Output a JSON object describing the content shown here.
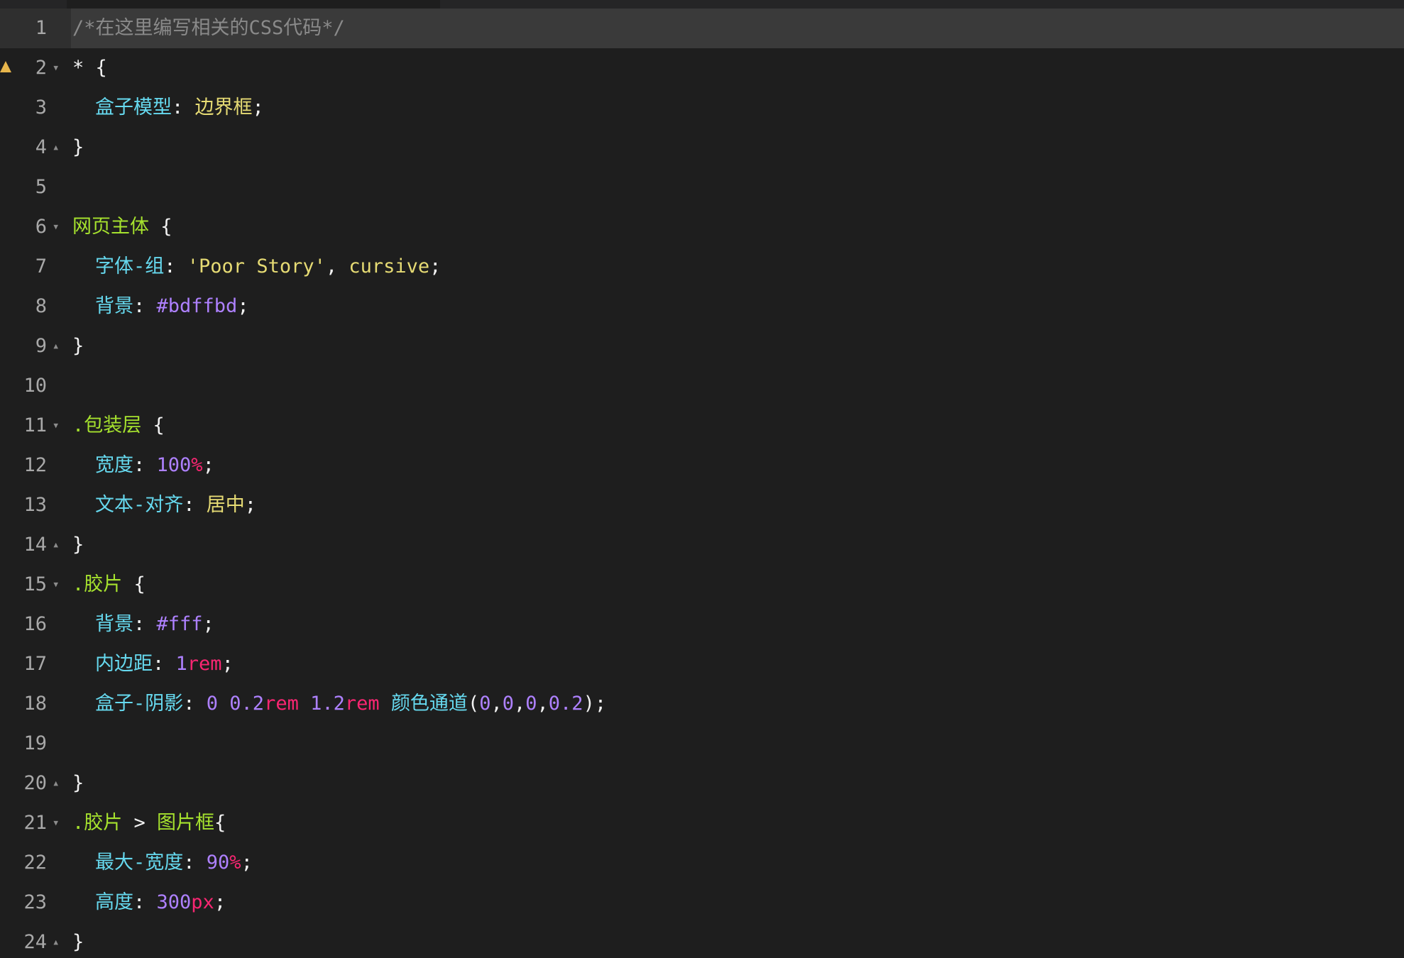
{
  "editor": {
    "lines": [
      {
        "n": "1",
        "fold": "",
        "tokens": [
          [
            "t-comment",
            "/*在这里编写相关的CSS代码*/"
          ]
        ]
      },
      {
        "n": "2",
        "fold": "▼",
        "tokens": [
          [
            "t-punct",
            "* {"
          ]
        ]
      },
      {
        "n": "3",
        "fold": "",
        "indent": 1,
        "tokens": [
          [
            "t-prop",
            "盒子模型"
          ],
          [
            "t-punct",
            ": "
          ],
          [
            "t-kw",
            "边界框"
          ],
          [
            "t-punct",
            ";"
          ]
        ]
      },
      {
        "n": "4",
        "fold": "▲",
        "tokens": [
          [
            "t-punct",
            "}"
          ]
        ]
      },
      {
        "n": "5",
        "fold": "",
        "tokens": []
      },
      {
        "n": "6",
        "fold": "▼",
        "tokens": [
          [
            "t-sel",
            "网页主体"
          ],
          [
            "t-punct",
            " {"
          ]
        ]
      },
      {
        "n": "7",
        "fold": "",
        "indent": 1,
        "tokens": [
          [
            "t-prop",
            "字体-组"
          ],
          [
            "t-punct",
            ": "
          ],
          [
            "t-str",
            "'Poor Story'"
          ],
          [
            "t-punct",
            ", "
          ],
          [
            "t-kw",
            "cursive"
          ],
          [
            "t-punct",
            ";"
          ]
        ]
      },
      {
        "n": "8",
        "fold": "",
        "indent": 1,
        "tokens": [
          [
            "t-prop",
            "背景"
          ],
          [
            "t-punct",
            ": "
          ],
          [
            "t-num",
            "#bdffbd"
          ],
          [
            "t-punct",
            ";"
          ]
        ]
      },
      {
        "n": "9",
        "fold": "▲",
        "tokens": [
          [
            "t-punct",
            "}"
          ]
        ]
      },
      {
        "n": "10",
        "fold": "",
        "tokens": []
      },
      {
        "n": "11",
        "fold": "▼",
        "tokens": [
          [
            "t-sel",
            ".包装层"
          ],
          [
            "t-punct",
            " {"
          ]
        ]
      },
      {
        "n": "12",
        "fold": "",
        "indent": 1,
        "tokens": [
          [
            "t-prop",
            "宽度"
          ],
          [
            "t-punct",
            ": "
          ],
          [
            "t-num",
            "100"
          ],
          [
            "t-unit",
            "%"
          ],
          [
            "t-punct",
            ";"
          ]
        ]
      },
      {
        "n": "13",
        "fold": "",
        "indent": 1,
        "tokens": [
          [
            "t-prop",
            "文本-对齐"
          ],
          [
            "t-punct",
            ": "
          ],
          [
            "t-kw",
            "居中"
          ],
          [
            "t-punct",
            ";"
          ]
        ]
      },
      {
        "n": "14",
        "fold": "▲",
        "tokens": [
          [
            "t-punct",
            "}"
          ]
        ]
      },
      {
        "n": "15",
        "fold": "▼",
        "tokens": [
          [
            "t-sel",
            ".胶片"
          ],
          [
            "t-punct",
            " {"
          ]
        ]
      },
      {
        "n": "16",
        "fold": "",
        "indent": 1,
        "tokens": [
          [
            "t-prop",
            "背景"
          ],
          [
            "t-punct",
            ": "
          ],
          [
            "t-num",
            "#fff"
          ],
          [
            "t-punct",
            ";"
          ]
        ]
      },
      {
        "n": "17",
        "fold": "",
        "indent": 1,
        "tokens": [
          [
            "t-prop",
            "内边距"
          ],
          [
            "t-punct",
            ": "
          ],
          [
            "t-num",
            "1"
          ],
          [
            "t-unit",
            "rem"
          ],
          [
            "t-punct",
            ";"
          ]
        ]
      },
      {
        "n": "18",
        "fold": "",
        "indent": 1,
        "tokens": [
          [
            "t-prop",
            "盒子-阴影"
          ],
          [
            "t-punct",
            ": "
          ],
          [
            "t-num",
            "0 0.2"
          ],
          [
            "t-unit",
            "rem"
          ],
          [
            "t-punct",
            " "
          ],
          [
            "t-num",
            "1.2"
          ],
          [
            "t-unit",
            "rem"
          ],
          [
            "t-punct",
            " "
          ],
          [
            "t-fn",
            "颜色通道"
          ],
          [
            "t-punct",
            "("
          ],
          [
            "t-num",
            "0"
          ],
          [
            "t-punct",
            ","
          ],
          [
            "t-num",
            "0"
          ],
          [
            "t-punct",
            ","
          ],
          [
            "t-num",
            "0"
          ],
          [
            "t-punct",
            ","
          ],
          [
            "t-num",
            "0.2"
          ],
          [
            "t-punct",
            ");"
          ]
        ]
      },
      {
        "n": "19",
        "fold": "",
        "tokens": []
      },
      {
        "n": "20",
        "fold": "▲",
        "tokens": [
          [
            "t-punct",
            "}"
          ]
        ]
      },
      {
        "n": "21",
        "fold": "▼",
        "tokens": [
          [
            "t-sel",
            ".胶片"
          ],
          [
            "t-punct",
            " > "
          ],
          [
            "t-sel",
            "图片框"
          ],
          [
            "t-punct",
            "{"
          ]
        ]
      },
      {
        "n": "22",
        "fold": "",
        "indent": 1,
        "tokens": [
          [
            "t-prop",
            "最大-宽度"
          ],
          [
            "t-punct",
            ": "
          ],
          [
            "t-num",
            "90"
          ],
          [
            "t-unit",
            "%"
          ],
          [
            "t-punct",
            ";"
          ]
        ]
      },
      {
        "n": "23",
        "fold": "",
        "indent": 1,
        "tokens": [
          [
            "t-prop",
            "高度"
          ],
          [
            "t-punct",
            ": "
          ],
          [
            "t-num",
            "300"
          ],
          [
            "t-unit",
            "px"
          ],
          [
            "t-punct",
            ";"
          ]
        ]
      },
      {
        "n": "24",
        "fold": "▲",
        "tokens": [
          [
            "t-punct",
            "}"
          ]
        ]
      }
    ],
    "active_line": 1,
    "warning_line": 2
  },
  "colors": {
    "background": "#1e1e1e",
    "active_line": "#3a3a3a",
    "selector": "#a6e22e",
    "property": "#66d9ef",
    "keyword": "#e6db74",
    "number": "#ae81ff",
    "unit": "#f92672",
    "comment": "#8a8a8a",
    "warning": "#e8b64c"
  }
}
